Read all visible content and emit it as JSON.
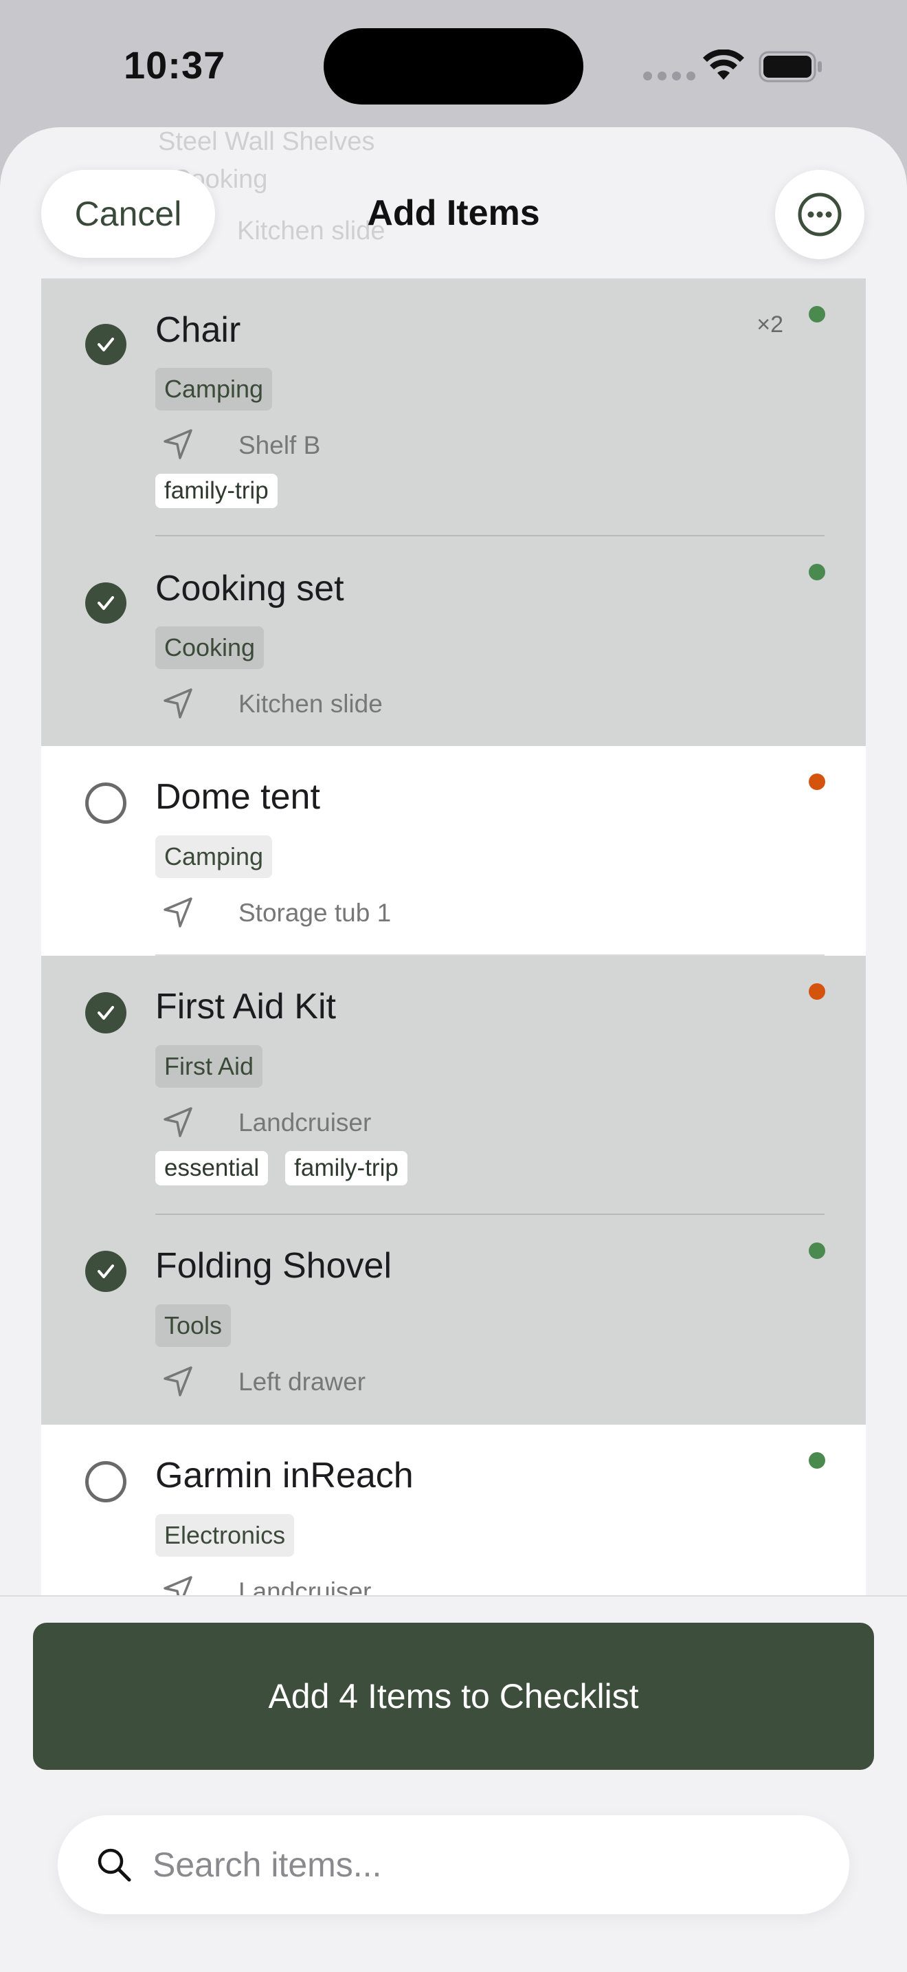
{
  "status_bar": {
    "time": "10:37"
  },
  "header": {
    "cancel_label": "Cancel",
    "title": "Add Items",
    "more_icon": "ellipsis-circle-icon"
  },
  "ghost_rows": [
    "Steel Wall Shelves",
    "Cooking",
    "Kitchen slide"
  ],
  "items": [
    {
      "name": "Chair",
      "checked": true,
      "quantity": "×2",
      "category": "Camping",
      "location": "Shelf B",
      "tags": [
        "family-trip"
      ],
      "status_color": "#4a8a4e"
    },
    {
      "name": "Cooking set",
      "checked": true,
      "quantity": "",
      "category": "Cooking",
      "location": "Kitchen slide",
      "tags": [],
      "status_color": "#4a8a4e"
    },
    {
      "name": "Dome tent",
      "checked": false,
      "quantity": "",
      "category": "Camping",
      "location": "Storage tub 1",
      "tags": [],
      "status_color": "#d4540e"
    },
    {
      "name": "First Aid Kit",
      "checked": true,
      "quantity": "",
      "category": "First Aid",
      "location": "Landcruiser",
      "tags": [
        "essential",
        "family-trip"
      ],
      "status_color": "#d4540e"
    },
    {
      "name": "Folding Shovel",
      "checked": true,
      "quantity": "",
      "category": "Tools",
      "location": "Left drawer",
      "tags": [],
      "status_color": "#4a8a4e"
    },
    {
      "name": "Garmin inReach",
      "checked": false,
      "quantity": "",
      "category": "Electronics",
      "location": "Landcruiser",
      "tags": [],
      "status_color": "#4a8a4e"
    }
  ],
  "footer": {
    "add_button_label": "Add 4 Items to Checklist",
    "search_placeholder": "Search items..."
  },
  "colors": {
    "accent": "#3e4e3d",
    "checked_row_bg": "#d4d6d6",
    "status_green": "#4a8a4e",
    "status_orange": "#d4540e"
  }
}
